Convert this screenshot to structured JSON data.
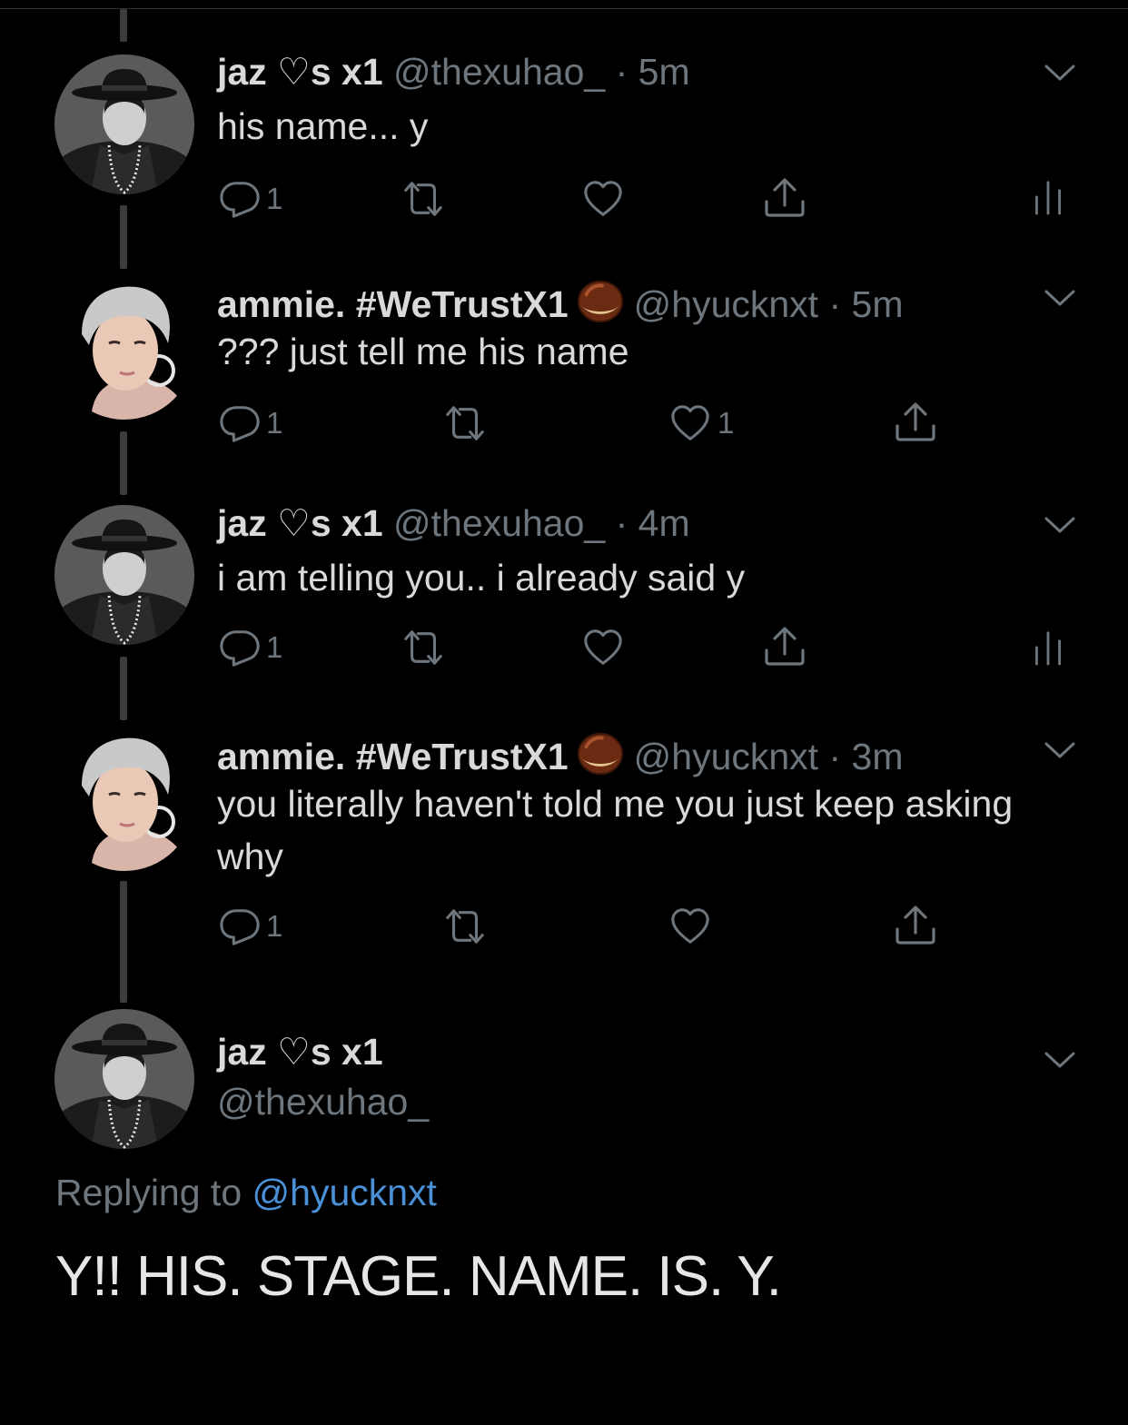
{
  "thread": {
    "tweets": [
      {
        "name": "jaz ♡s x1",
        "handle": "@thexuhao_",
        "separator": "·",
        "time": "5m",
        "text": "his name... y",
        "reply_count": "1",
        "retweet_count": "",
        "like_count": "",
        "avatar": "black-hat-avatar"
      },
      {
        "name": "ammie. #WeTrustX1",
        "handle": "@hyucknxt",
        "separator": "·",
        "time": "5m",
        "text": "??? just tell me his name",
        "reply_count": "1",
        "retweet_count": "",
        "like_count": "1",
        "avatar": "silver-hair-avatar",
        "name_emoji": "chestnut-icon"
      },
      {
        "name": "jaz ♡s x1",
        "handle": "@thexuhao_",
        "separator": "·",
        "time": "4m",
        "text": "i am telling you.. i already said y",
        "reply_count": "1",
        "retweet_count": "",
        "like_count": "",
        "avatar": "black-hat-avatar"
      },
      {
        "name": "ammie. #WeTrustX1",
        "handle": "@hyucknxt",
        "separator": "·",
        "time": "3m",
        "text": "you literally haven't told me you just keep asking why",
        "reply_count": "1",
        "retweet_count": "",
        "like_count": "",
        "avatar": "silver-hair-avatar",
        "name_emoji": "chestnut-icon"
      }
    ]
  },
  "focused": {
    "name": "jaz ♡s x1",
    "handle": "@thexuhao_",
    "replying_prefix": "Replying to",
    "replying_to": "@hyucknxt",
    "text": "Y!! HIS. STAGE. NAME. IS. Y."
  },
  "colors": {
    "background": "#000000",
    "text": "#d9d9d9",
    "muted": "#6e767d",
    "link": "#4a90d6",
    "thread_line": "#3a3d40"
  }
}
